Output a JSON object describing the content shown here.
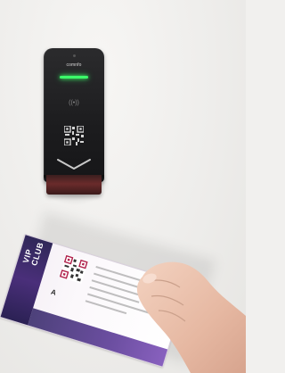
{
  "reader": {
    "brand_label": "comnfo",
    "nfc_symbol": "((•))",
    "icons": {
      "status_light": "green-led-bar",
      "nfc": "contactless-icon",
      "qr": "qr-code-icon",
      "scan_direction": "chevron-down-icon"
    },
    "colors": {
      "body": "#1c1c1e",
      "led": "#3cff6a",
      "base": "#6a2b2b"
    }
  },
  "ticket": {
    "stub_label": "VIP CLUB",
    "section_letter": "A",
    "colors": {
      "stub": "#3a2d6c",
      "paper": "#f7f2f8"
    }
  }
}
